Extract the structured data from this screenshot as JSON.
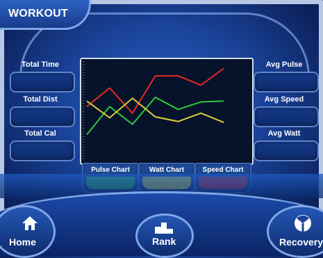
{
  "header": {
    "title": "WORKOUT"
  },
  "left_stats": [
    {
      "label": "Total Time",
      "value": ""
    },
    {
      "label": "Total Dist",
      "value": ""
    },
    {
      "label": "Total Cal",
      "value": ""
    }
  ],
  "right_stats": [
    {
      "label": "Avg Pulse",
      "value": ""
    },
    {
      "label": "Avg Speed",
      "value": ""
    },
    {
      "label": "Avg Watt",
      "value": ""
    }
  ],
  "chart_tabs": [
    {
      "label": "Pulse Chart",
      "color": "#36c73e"
    },
    {
      "label": "Watt Chart",
      "color": "#f4ea24"
    },
    {
      "label": "Speed Chart",
      "color": "#e52626"
    }
  ],
  "nav": {
    "home": {
      "label": "Home",
      "icon": "home-icon"
    },
    "rank": {
      "label": "Rank",
      "icon": "rank-icon"
    },
    "recovery": {
      "label": "Recovery",
      "icon": "recovery-icon"
    }
  },
  "chart_data": {
    "type": "line",
    "x": [
      0,
      1,
      2,
      3,
      4,
      5,
      6,
      7
    ],
    "ylim": [
      0,
      100
    ],
    "grid": false,
    "series": [
      {
        "color": "#e62a25",
        "values": [
          55,
          75,
          48,
          88,
          88,
          78,
          96,
          null
        ]
      },
      {
        "color": "#2fc840",
        "values": [
          25,
          55,
          36,
          65,
          52,
          60,
          61,
          null
        ]
      },
      {
        "color": "#d9cf36",
        "values": [
          61,
          43,
          64,
          44,
          39,
          48,
          38,
          null
        ]
      }
    ]
  }
}
